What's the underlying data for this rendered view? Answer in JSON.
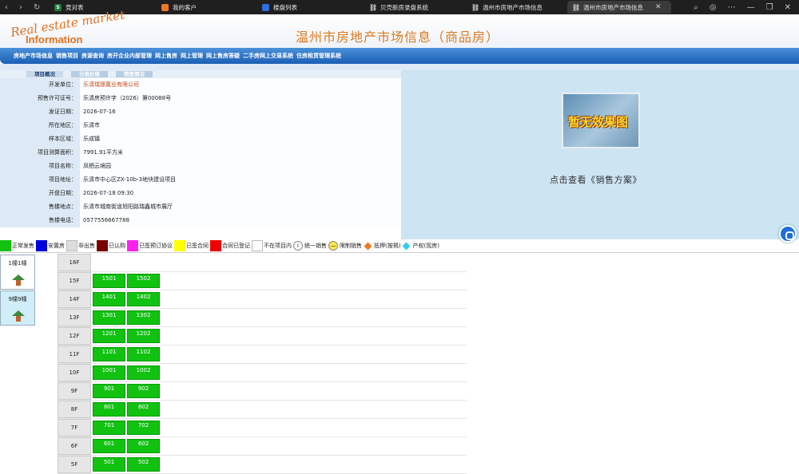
{
  "browser": {
    "tabs": [
      {
        "label": "竞对表",
        "icon": "spreadsheet-icon",
        "color": "#1f7a3e",
        "glyph": "S"
      },
      {
        "label": "我的客户",
        "icon": "app-icon",
        "color": "#f07820",
        "glyph": ""
      },
      {
        "label": "楼盘列表",
        "icon": "app-icon",
        "color": "#2f6fe0",
        "glyph": ""
      },
      {
        "label": "贝壳新房录盘系统",
        "icon": "link-icon",
        "color": "",
        "glyph": ""
      },
      {
        "label": "温州市房地产市场信息",
        "icon": "link-icon",
        "color": "",
        "glyph": ""
      },
      {
        "label": "温州市房地产市场信息",
        "icon": "link-icon",
        "color": "",
        "glyph": "",
        "active": true
      }
    ]
  },
  "header": {
    "logo_top": "Real estate market",
    "logo_bottom": "Information",
    "title": "温州市房地产市场信息（商品房）"
  },
  "menu": [
    "房地产市场信息",
    "销售项目",
    "房源查询",
    "房开企业内部管理",
    "网上售房",
    "网上管理",
    "网上售房答疑",
    "二手房网上交易系统",
    "住房租赁管理系统"
  ],
  "subtabs": [
    "项目概况",
    "分类价格",
    "销售情况"
  ],
  "project": [
    {
      "label": "开发单位：",
      "value": "乐清瑞璟置业有限公司",
      "link": true
    },
    {
      "label": "预售许可证号：",
      "value": "乐清房预许字（2026）第00088号"
    },
    {
      "label": "发证日期：",
      "value": "2026-07-16"
    },
    {
      "label": "所在地区：",
      "value": "乐清市"
    },
    {
      "label": "样本区域：",
      "value": "乐成镇"
    },
    {
      "label": "项目测算面积：",
      "value": "7991.91平方米"
    },
    {
      "label": "项目名称：",
      "value": "凤栖云境园"
    },
    {
      "label": "项目地址：",
      "value": "乐清市中心区ZX-10b-3地块建设项目"
    },
    {
      "label": "开盘日期：",
      "value": "2026-07-18 09:30"
    },
    {
      "label": "售楼地点：",
      "value": "乐清市城南街道旭阳路瑞鑫城市展厅"
    },
    {
      "label": "售楼电话：",
      "value": "0577556667788"
    }
  ],
  "image_text": "暂无效果图",
  "sale_plan_link": "点击查看《销售方案》",
  "legend": [
    {
      "label": "正常发售",
      "color": "#11c211",
      "kind": "swatch"
    },
    {
      "label": "安置房",
      "color": "#0000dd",
      "kind": "swatch"
    },
    {
      "label": "非出售",
      "color": "#dcdcdc",
      "kind": "swatch"
    },
    {
      "label": "已认购",
      "color": "#7a0000",
      "kind": "swatch"
    },
    {
      "label": "已签预订协议",
      "color": "#ff22ee",
      "kind": "swatch"
    },
    {
      "label": "已签合同",
      "color": "#ffff00",
      "kind": "swatch"
    },
    {
      "label": "合同已登记",
      "color": "#ee0000",
      "kind": "swatch"
    },
    {
      "label": "不在项目内",
      "color": "#ffffff",
      "kind": "swatch"
    },
    {
      "label": "统一销售",
      "color": "#ffffff",
      "kind": "circle",
      "glyph": "i"
    },
    {
      "label": "限制销售",
      "color": "#ffe84d",
      "kind": "circle",
      "glyph": "—"
    },
    {
      "label": "抵押(按揭)",
      "color": "#f07820",
      "kind": "diamond"
    },
    {
      "label": "产权(现房)",
      "color": "#33ccee",
      "kind": "diamond"
    }
  ],
  "buildings": [
    {
      "label": "1幢1幢",
      "selected": false
    },
    {
      "label": "9幢9幢",
      "selected": true
    }
  ],
  "floors": [
    {
      "floor": "16F",
      "units": []
    },
    {
      "floor": "15F",
      "units": [
        "1501",
        "1502"
      ]
    },
    {
      "floor": "14F",
      "units": [
        "1401",
        "1402"
      ]
    },
    {
      "floor": "13F",
      "units": [
        "1301",
        "1302"
      ]
    },
    {
      "floor": "12F",
      "units": [
        "1201",
        "1202"
      ]
    },
    {
      "floor": "11F",
      "units": [
        "1101",
        "1102"
      ]
    },
    {
      "floor": "10F",
      "units": [
        "1001",
        "1002"
      ]
    },
    {
      "floor": "9F",
      "units": [
        "901",
        "902"
      ]
    },
    {
      "floor": "8F",
      "units": [
        "801",
        "802"
      ]
    },
    {
      "floor": "7F",
      "units": [
        "701",
        "702"
      ]
    },
    {
      "floor": "6F",
      "units": [
        "601",
        "602"
      ]
    },
    {
      "floor": "5F",
      "units": [
        "501",
        "502"
      ]
    }
  ]
}
